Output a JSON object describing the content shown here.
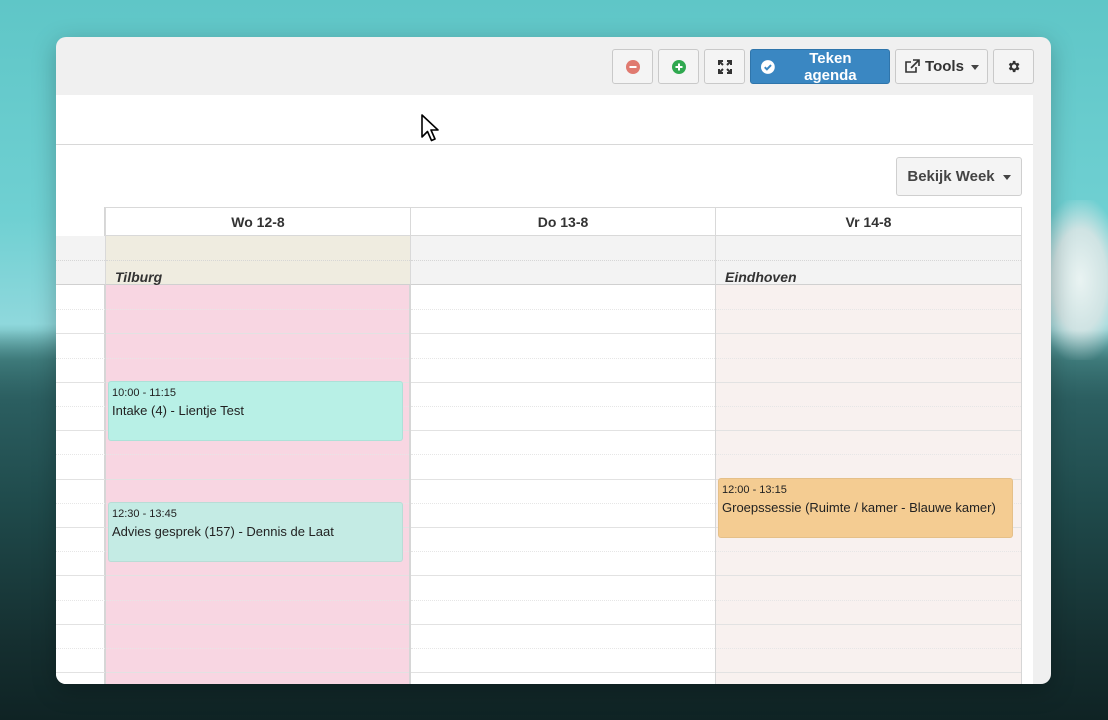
{
  "toolbar": {
    "zoom_out_icon": "minus-circle-icon",
    "zoom_in_icon": "plus-circle-icon",
    "fullscreen_icon": "expand-icon",
    "primary_label": "Teken agenda",
    "primary_icon": "check-circle-icon",
    "tools_label": "Tools",
    "tools_icon": "external-link-icon",
    "settings_icon": "gear-icon"
  },
  "view": {
    "label": "Bekijk Week"
  },
  "days": [
    {
      "header": "Wo 12-8",
      "location": "Tilburg"
    },
    {
      "header": "Do 13-8",
      "location": ""
    },
    {
      "header": "Vr 14-8",
      "location": "Eindhoven"
    }
  ],
  "events": [
    {
      "day": 0,
      "time": "10:00 - 11:15",
      "title": "Intake (4) - Lientje Test"
    },
    {
      "day": 0,
      "time": "12:30 - 13:45",
      "title": "Advies gesprek (157) - Dennis de Laat"
    },
    {
      "day": 2,
      "time": "12:00 - 13:15",
      "title": "Groepssessie (Ruimte / kamer - Blauwe kamer)"
    }
  ],
  "colors": {
    "primary": "#3a87c2",
    "zoom_out": "#e07a70",
    "zoom_in": "#2fa84f",
    "tilburg_day": "#f8d6e2",
    "tilburg_allday": "#efece0",
    "eindhoven_day": "#f8f1ef",
    "event_intake": "#b8f0e6",
    "event_advies": "#c4ebe4",
    "event_groep": "#f4cc92"
  }
}
